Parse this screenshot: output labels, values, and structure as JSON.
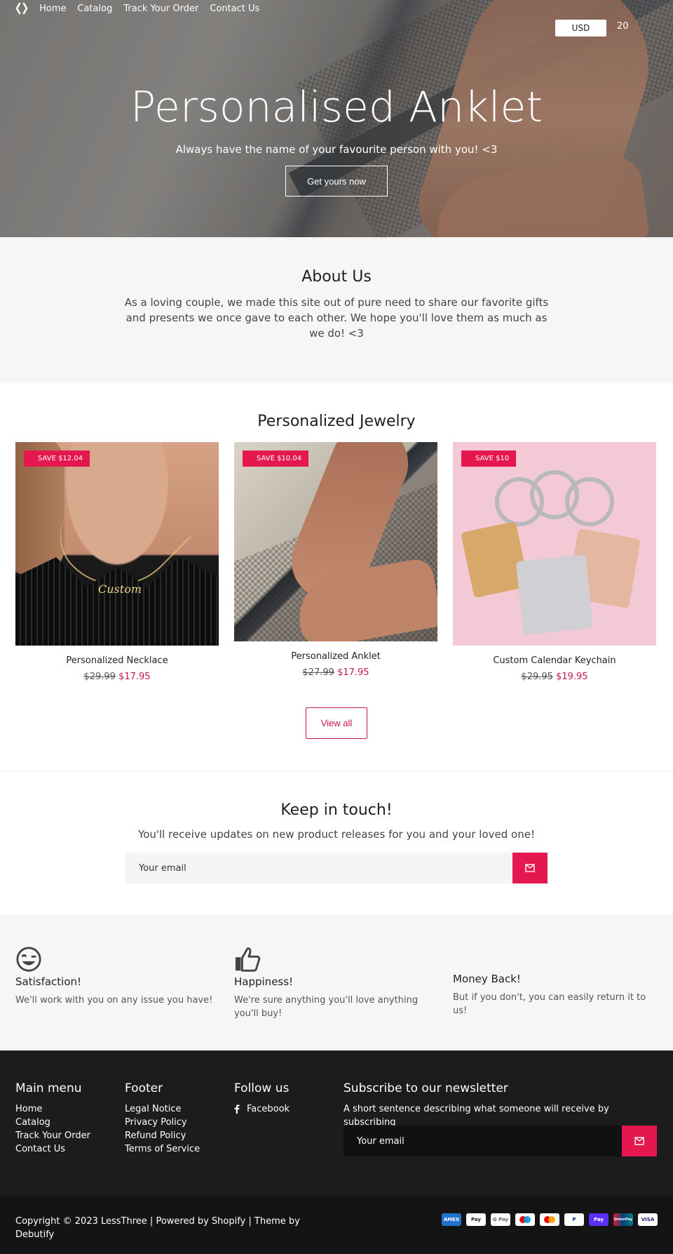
{
  "header": {
    "nav": [
      "Home",
      "Catalog",
      "Track Your Order",
      "Contact Us"
    ],
    "currency": "USD",
    "cart_count": "20"
  },
  "hero": {
    "title": "Personalised Anklet",
    "subtitle": "Always have the name of your favourite person with you! <3",
    "button": "Get yours now"
  },
  "about": {
    "title": "About Us",
    "text": "As a loving couple, we made this site out of pure need to share our favorite gifts and presents we  once gave to each other. We hope you'll love them as much as we do! <3"
  },
  "collection": {
    "title": "Personalized Jewelry",
    "products": [
      {
        "badge": "SAVE $12.04",
        "name": "Personalized Necklace",
        "old_price": "$29.99",
        "price": "$17.95"
      },
      {
        "badge": "SAVE $10.04",
        "name": "Personalized Anklet",
        "old_price": "$27.99",
        "price": "$17.95"
      },
      {
        "badge": "SAVE $10",
        "name": "Custom Calendar Keychain",
        "old_price": "$29.95",
        "price": "$19.95"
      }
    ],
    "view_all": "View all"
  },
  "newsletter": {
    "title": "Keep in touch!",
    "subtitle": "You'll receive updates on new product releases for you and your loved one!",
    "placeholder": "Your email"
  },
  "features": [
    {
      "icon": "winking-face-icon",
      "title": "Satisfaction!",
      "text": "We'll work with you on any issue you have!"
    },
    {
      "icon": "thumbs-up-icon",
      "title": "Happiness!",
      "text": "We're sure anything you'll love anything you'll buy!"
    },
    {
      "icon": "",
      "title": "Money Back!",
      "text": "But if you don't, you can easily return it to us!"
    }
  ],
  "footer": {
    "main_menu": {
      "title": "Main menu",
      "links": [
        "Home",
        "Catalog",
        "Track Your Order",
        "Contact Us"
      ]
    },
    "footer_menu": {
      "title": "Footer",
      "links": [
        "Legal Notice",
        "Privacy Policy",
        "Refund Policy",
        "Terms of Service"
      ]
    },
    "follow": {
      "title": "Follow us",
      "links": [
        "Facebook"
      ]
    },
    "subscribe": {
      "title": "Subscribe to our newsletter",
      "text": "A short sentence describing what someone will receive by subscribing",
      "placeholder": "Your email"
    },
    "copyright": "Copyright © 2023 LessThree | Powered by Shopify | Theme by Debutify",
    "payments": [
      "AMEX",
      "Pay",
      "G Pay",
      "",
      "",
      "P",
      "Pay",
      "UnionPay",
      "VISA"
    ]
  },
  "colors": {
    "accent": "#e5174f",
    "sale_price": "#c2184b",
    "footer_bg": "#1c1c1c",
    "section_bg": "#f6f6f6"
  }
}
